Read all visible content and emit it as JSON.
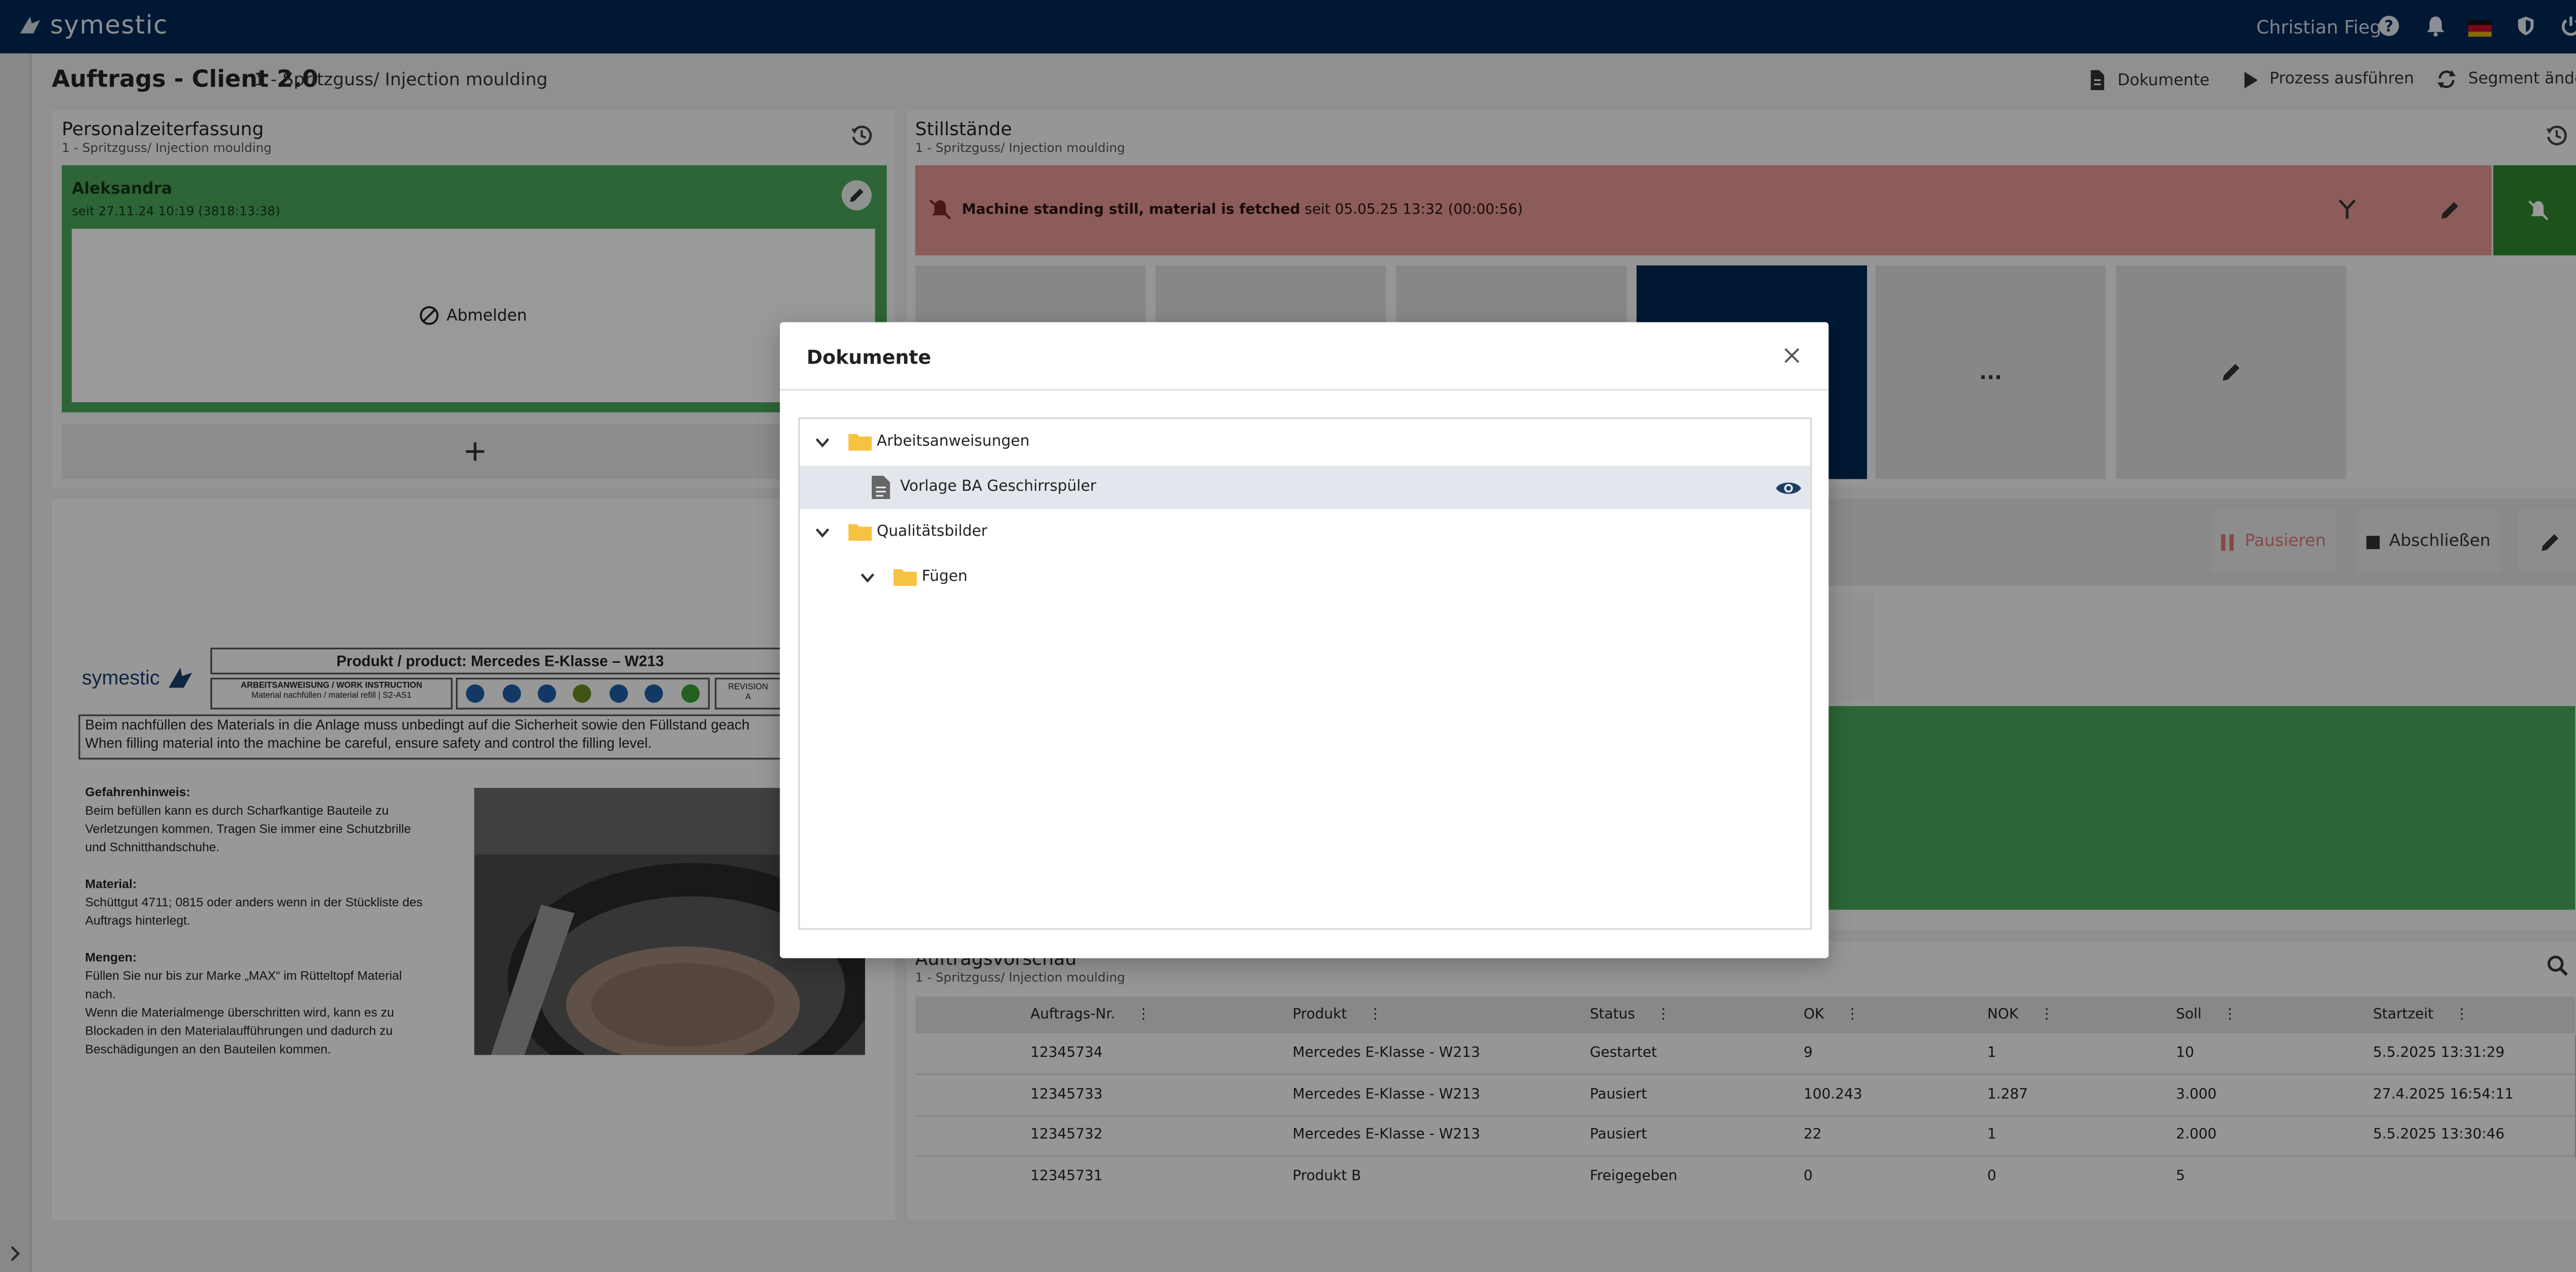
{
  "header": {
    "brand": "symestic",
    "user_name": "Christian Fieg",
    "icons": [
      "help-icon",
      "bell-icon",
      "flag-de-icon",
      "shield-icon",
      "power-icon"
    ]
  },
  "subheader": {
    "app_title": "Auftrags - Client 2.0",
    "segment": "1 - Spritzguss/ Injection moulding",
    "actions": {
      "documents": "Dokumente",
      "run_process": "Prozess ausführen",
      "change_segment": "Segment ändern"
    }
  },
  "personnel": {
    "title": "Personalzeiterfassung",
    "subtitle": "1 - Spritzguss/ Injection moulding",
    "person_name": "Aleksandra",
    "person_since": "seit 27.11.24 10:19 (3818:13:38)",
    "logout_label": "Abmelden"
  },
  "instruction_doc": {
    "logo": "symestic",
    "product": "Produkt / product: Mercedes E-Klasse – W213",
    "instruction_label": "ARBEITSANWEISUNG / WORK INSTRUCTION",
    "instruction_sub": "Material nachfüllen / material refill | S2-AS1",
    "revision_label": "REVISION",
    "revision_value": "A",
    "intro_de": "Beim nachfüllen des Materials in die Anlage muss unbedingt auf die Sicherheit sowie den Füllstand geach",
    "intro_en": "When filling material into the machine be careful, ensure safety and control the filling level.",
    "hazard_title": "Gefahrenhinweis:",
    "hazard_lines": [
      "Beim befüllen kann es durch Scharfkantige Bauteile zu",
      "Verletzungen kommen. Tragen Sie immer eine Schutzbrille",
      "und Schnitthandschuhe."
    ],
    "material_title": "Material:",
    "material_lines": [
      "Schüttgut 4711; 0815 oder anders wenn in der Stückliste des",
      "Auftrags hinterlegt."
    ],
    "amounts_title": "Mengen:",
    "amounts_lines": [
      "Füllen Sie nur bis zur Marke „MAX“ im Rütteltopf Material",
      "nach.",
      "Wenn die Materialmenge überschritten wird, kann es zu",
      "Blockaden in den Materialaufführungen und dadurch zu",
      "Beschädigungen an den Bauteilen kommen."
    ]
  },
  "downtimes": {
    "title": "Stillstände",
    "subtitle": "1 - Spritzguss/ Injection moulding",
    "alert_title": "Machine standing still, material is fetched",
    "alert_since": "seit 05.05.25 13:32 (00:00:56)",
    "more_label": "..."
  },
  "order_actions": {
    "pause": "Pausieren",
    "finish": "Abschließen"
  },
  "order_preview": {
    "title": "Auftragsvorschau",
    "subtitle": "1 - Spritzguss/ Injection moulding",
    "columns": [
      "Auftrags-Nr.",
      "Produkt",
      "Status",
      "OK",
      "NOK",
      "Soll",
      "Startzeit"
    ],
    "rows": [
      [
        "12345734",
        "Mercedes E-Klasse - W213",
        "Gestartet",
        "9",
        "1",
        "10",
        "5.5.2025 13:31:29"
      ],
      [
        "12345733",
        "Mercedes E-Klasse - W213",
        "Pausiert",
        "100.243",
        "1.287",
        "3.000",
        "27.4.2025 16:54:11"
      ],
      [
        "12345732",
        "Mercedes E-Klasse - W213",
        "Pausiert",
        "22",
        "1",
        "2.000",
        "5.5.2025 13:30:46"
      ],
      [
        "12345731",
        "Produkt B",
        "Freigegeben",
        "0",
        "0",
        "5",
        ""
      ]
    ]
  },
  "modal": {
    "title": "Dokumente",
    "tree": {
      "folder1": "Arbeitsanweisungen",
      "file1": "Vorlage BA Geschirrspüler",
      "folder2": "Qualitätsbilder",
      "subfolder": "Fügen"
    }
  },
  "colors": {
    "header_bg": "#002856",
    "alert_red": "#e89a95",
    "ok_green": "#4ca85a",
    "dark_green": "#2e8b2e",
    "navy_tile": "#002856",
    "pause_red": "#e07a7a"
  }
}
